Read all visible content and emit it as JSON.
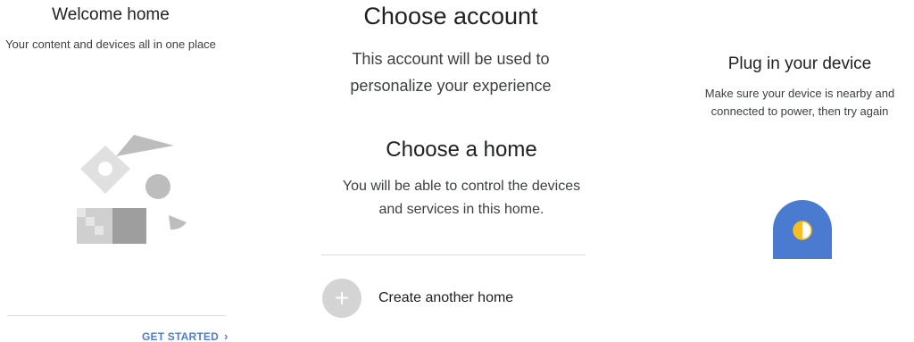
{
  "welcome": {
    "title": "Welcome home",
    "subtitle": "Your content and devices all in one place",
    "cta_label": "GET STARTED",
    "cta_chevron": "›"
  },
  "account": {
    "title": "Choose account",
    "subtitle": "This account will be used to personalize your experience"
  },
  "home": {
    "title": "Choose a home",
    "subtitle": "You will be able to control the devices and services in this home.",
    "create_icon": "+",
    "create_label": "Create another home"
  },
  "plug": {
    "title": "Plug in your device",
    "subtitle": "Make sure your device is nearby and connected to power, then try again"
  },
  "colors": {
    "accent": "#4a7fd4",
    "device_blue": "#4b7bd0",
    "device_yellow": "#f6be1e",
    "plus_circle": "#d4d4d4"
  },
  "icons": {
    "welcome_illustration": "home-shapes-illustration",
    "device_illustration": "plug-device-illustration",
    "cta_icon": "chevron-right-icon",
    "create_icon": "plus-icon"
  }
}
